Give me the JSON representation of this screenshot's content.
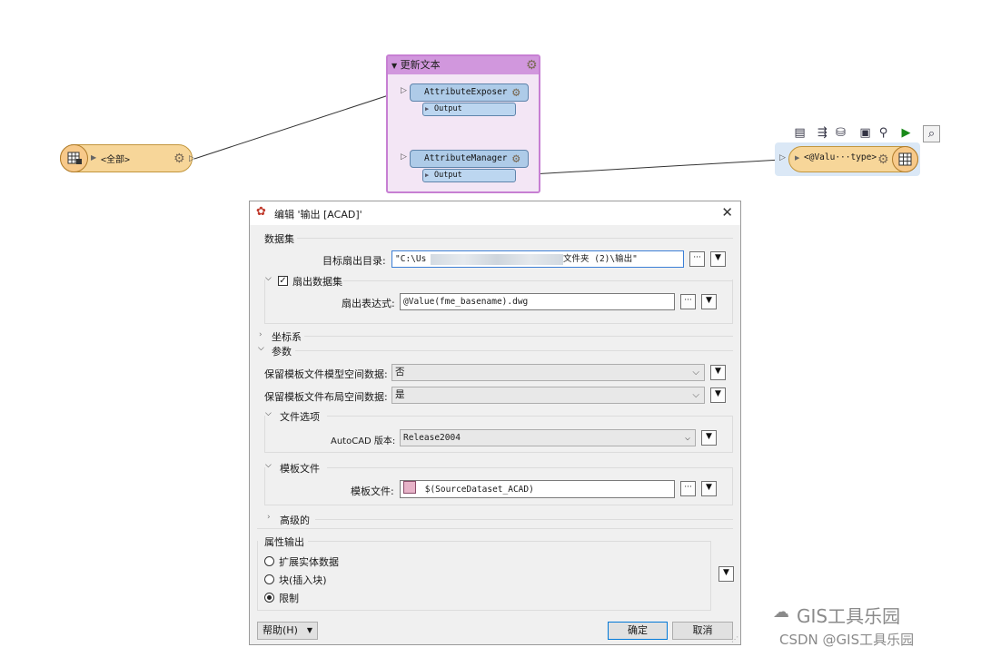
{
  "canvas": {
    "reader": {
      "label": "<全部>"
    },
    "bookmark": {
      "title": "更新文本"
    },
    "transformers": [
      {
        "name": "AttributeExposer",
        "output": "Output"
      },
      {
        "name": "AttributeManager",
        "output": "Output"
      }
    ],
    "writer": {
      "label": "<@Valu···type>"
    }
  },
  "dialog": {
    "title": "编辑 '输出 [ACAD]'",
    "dataset": {
      "section_label": "数据集",
      "target_dir_label": "目标扇出目录:",
      "target_dir_prefix": "\"C:\\Us",
      "target_dir_suffix": "文件夹 (2)\\输出\"",
      "fanout_checkbox_label": "扇出数据集",
      "fanout_expr_label": "扇出表达式:",
      "fanout_expr_value": "@Value(fme_basename).dwg"
    },
    "coord_section": "坐标系",
    "params_section": "参数",
    "keep_model_label": "保留模板文件模型空间数据:",
    "keep_model_value": "否",
    "keep_layout_label": "保留模板文件布局空间数据:",
    "keep_layout_value": "是",
    "file_options_section": "文件选项",
    "autocad_version_label": "AutoCAD 版本:",
    "autocad_version_value": "Release2004",
    "template_section": "模板文件",
    "template_file_label": "模板文件:",
    "template_file_value": "$(SourceDataset_ACAD)",
    "advanced_section": "高级的",
    "attr_output_section": "属性输出",
    "radio_options": [
      "扩展实体数据",
      "块(插入块)",
      "限制"
    ],
    "help_button": "帮助(H)",
    "ok_button": "确定",
    "cancel_button": "取消"
  },
  "watermark": {
    "line1": "GIS工具乐园",
    "line2": "CSDN @GIS工具乐园"
  }
}
